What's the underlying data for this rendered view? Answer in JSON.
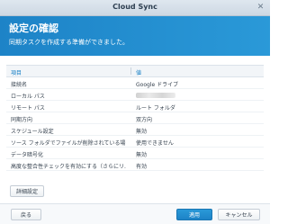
{
  "window": {
    "title": "Cloud Sync",
    "close_symbol": "✕"
  },
  "banner": {
    "heading": "設定の確認",
    "subheading": "同期タスクを作成する準備ができました。"
  },
  "table": {
    "header_item": "項目",
    "header_value": "値",
    "rows": [
      {
        "item": "接続名",
        "value": "Google ドライブ"
      },
      {
        "item": "ローカル パス",
        "value": ""
      },
      {
        "item": "リモート パス",
        "value": "ルート フォルダ"
      },
      {
        "item": "同期方向",
        "value": "双方向"
      },
      {
        "item": "スケジュール設定",
        "value": "無効"
      },
      {
        "item": "ソース フォルダでファイルが削除されている場...",
        "value": "使用できません"
      },
      {
        "item": "データ暗号化",
        "value": "無効"
      },
      {
        "item": "高度な整合性チェックを有効にする（さらにリ...",
        "value": "有効"
      }
    ]
  },
  "buttons": {
    "advanced": "詳細設定",
    "back": "戻る",
    "apply": "適用",
    "cancel": "キャンセル"
  },
  "colors": {
    "accent": "#1d83c7",
    "banner": "#2a99d8"
  },
  "icons": {
    "close": "close-icon"
  }
}
